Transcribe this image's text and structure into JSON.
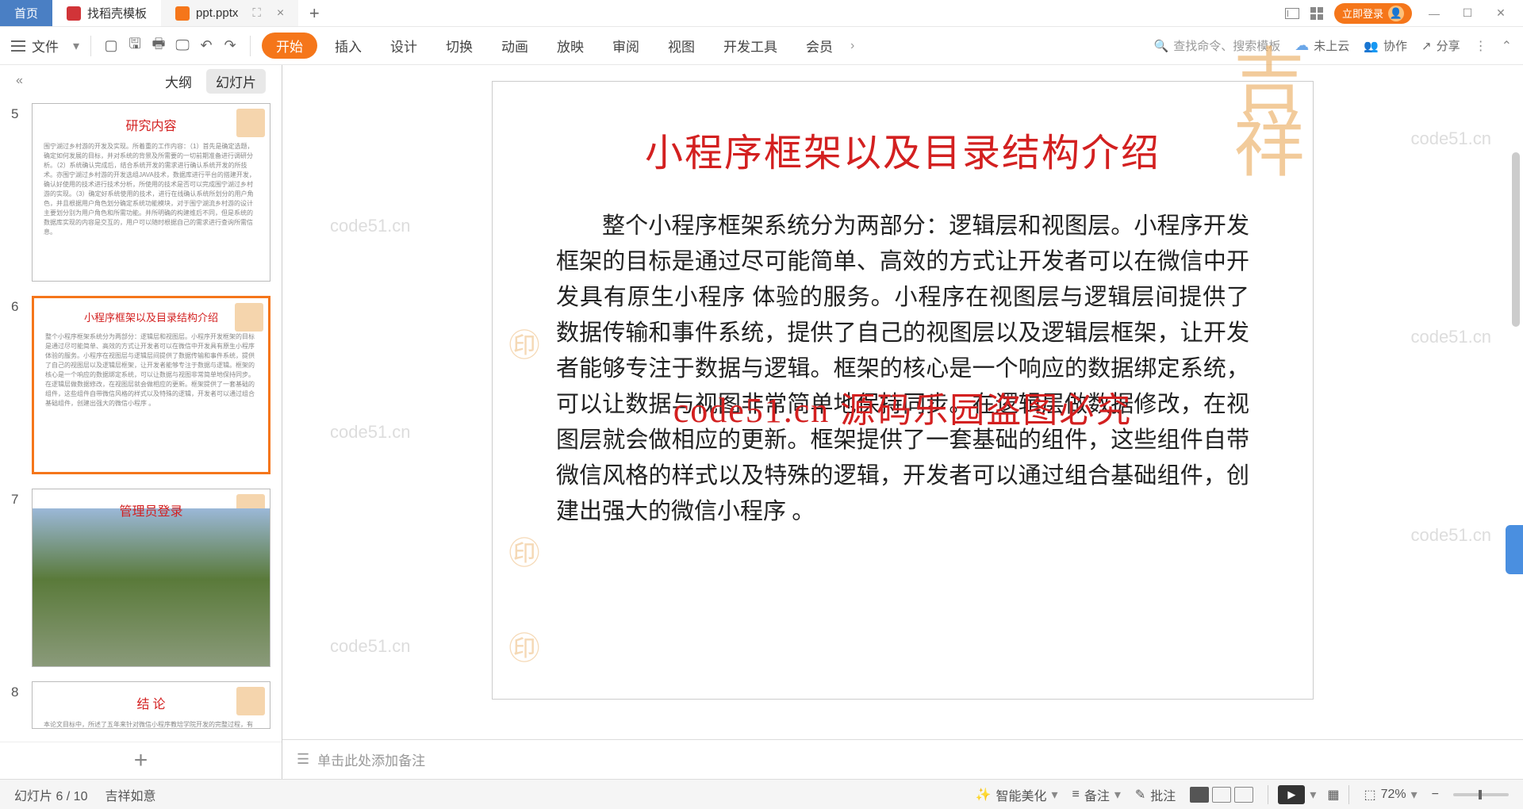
{
  "titlebar": {
    "tab_home": "首页",
    "tab_find": "找稻壳模板",
    "tab_ppt": "ppt.pptx",
    "login": "立即登录"
  },
  "ribbon": {
    "file": "文件",
    "tabs": {
      "start": "开始",
      "insert": "插入",
      "design": "设计",
      "transition": "切换",
      "animation": "动画",
      "slideshow": "放映",
      "review": "审阅",
      "view": "视图",
      "developer": "开发工具",
      "member": "会员"
    },
    "search_placeholder": "查找命令、搜索模板",
    "cloud": "未上云",
    "collab": "协作",
    "share": "分享"
  },
  "panel": {
    "outline": "大纲",
    "slides": "幻灯片"
  },
  "thumbs": [
    {
      "num": "5",
      "title": "研究内容",
      "text": "围宁湖过乡村游的开发及实现。所着重的工作内容：（1）首先是确定选题，确定如何发展的目标，并对系统的背景及所需要的一切前期准备进行调研分析。（2）系统确认完成后，结合系统开发的需求进行确认系统开发的所技术。亦围宁湖过乡村游的开发选组JAVA技术，数据库进行平台的搭建开发，确认好使用的技术进行技术分析，所使用的技术是否可以完成围宁湖过乡村游的实现。（3）确定好系统使用的技术，进行在线确认系统所划分的用户角色，并且根据用户角色划分确定系统功能模块，对于围宁湖流乡村游的设计主要划分别为用户角色和所需功能。并所明确的构建维后不同，但是系统的数据库实现的内容是交互的，用户可以随时根据自己的需求进行查询所需信息。"
    },
    {
      "num": "6",
      "title": "小程序框架以及目录结构介绍",
      "text": "整个小程序框架系统分为两部分：逻辑层和视图层。小程序开发框架的目标是通过尽可能简单、高效的方式让开发者可以在微信中开发具有原生小程序 体验的服务。小程序在视图层与逻辑层间提供了数据传输和事件系统，提供了自己的视图层以及逻辑层框架，让开发者能够专注于数据与逻辑。框架的核心是一个响应的数据绑定系统，可以让数据与视图非常简单地保持同步。在逻辑层做数据修改，在视图层就会做相应的更新。框架提供了一套基础的组件，这些组件自带微信风格的样式以及特殊的逻辑，开发者可以通过组合基础组件，创建出强大的微信小程序 。"
    },
    {
      "num": "7",
      "title": "管理员登录",
      "text": ""
    },
    {
      "num": "8",
      "title": "结 论",
      "text": "本论文目标中，所述了五年来针对微信小程序教培学院开发的完整过程，有着丰富..."
    }
  ],
  "slide": {
    "title": "小程序框架以及目录结构介绍",
    "body": "整个小程序框架系统分为两部分：逻辑层和视图层。小程序开发框架的目标是通过尽可能简单、高效的方式让开发者可以在微信中开发具有原生小程序 体验的服务。小程序在视图层与逻辑层间提供了数据传输和事件系统，提供了自己的视图层以及逻辑层框架，让开发者能够专注于数据与逻辑。框架的核心是一个响应的数据绑定系统，可以让数据与视图非常简单地保持同步。在逻辑层做数据修改，在视图层就会做相应的更新。框架提供了一套基础的组件，这些组件自带微信风格的样式以及特殊的逻辑，开发者可以通过组合基础组件，创建出强大的微信小程序 。",
    "overlay": "code51.cn 源码乐园盗图必究"
  },
  "notes": {
    "placeholder": "单击此处添加备注"
  },
  "statusbar": {
    "slide_count": "幻灯片 6 / 10",
    "theme": "吉祥如意",
    "beautify": "智能美化",
    "notes": "备注",
    "comments": "批注",
    "zoom": "72%"
  },
  "watermarks": [
    "code51.cn",
    "code51.cn",
    "code51.cn",
    "code51.cn",
    "code51.cn",
    "code51.cn",
    "code51.cn"
  ]
}
